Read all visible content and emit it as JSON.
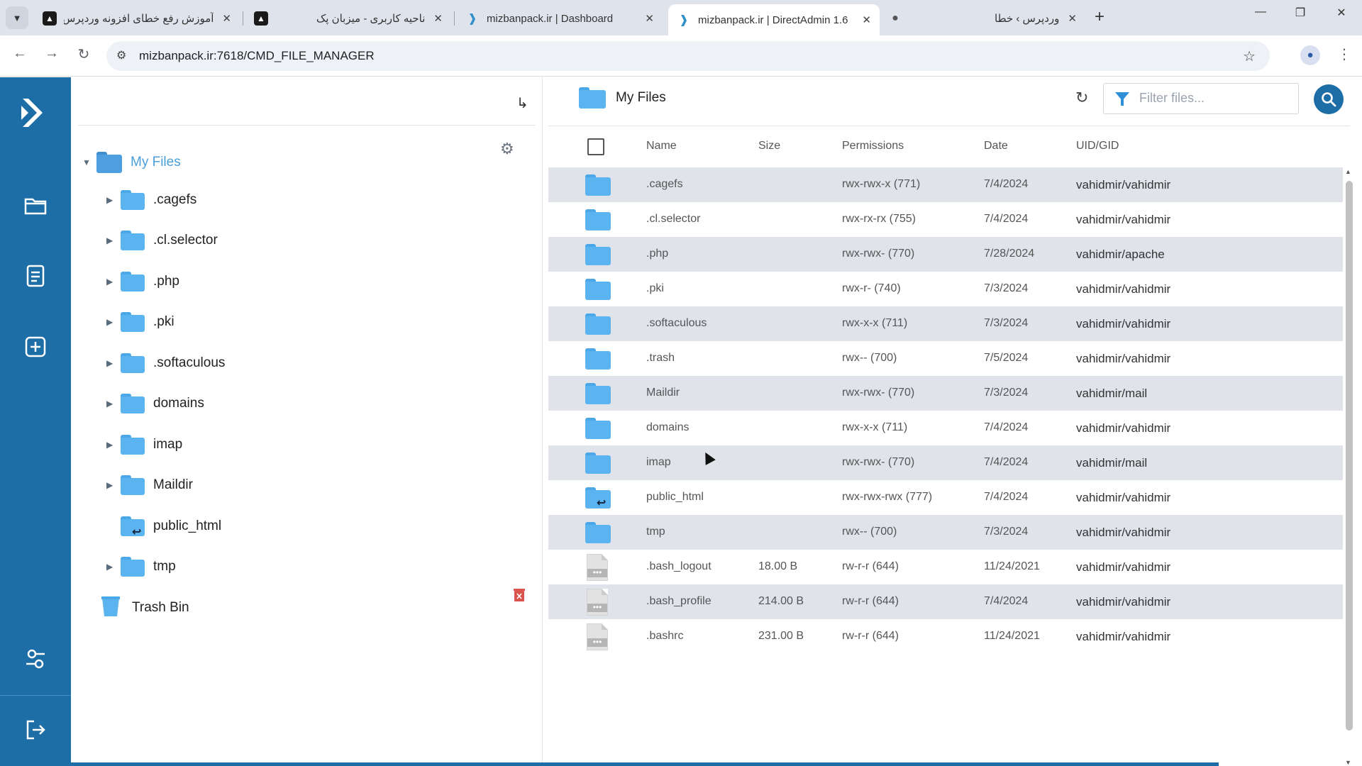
{
  "browser": {
    "tabs": [
      {
        "title": "آموزش رفع خطای افزونه وردپرس",
        "favicon": "tab-logo-icon",
        "active": false
      },
      {
        "title": "ناحیه کاربری - میزبان پک",
        "favicon": "tab-logo-icon",
        "active": false
      },
      {
        "title": "mizbanpack.ir | Dashboard",
        "favicon": "directadmin-icon",
        "active": false
      },
      {
        "title": "mizbanpack.ir | DirectAdmin 1.6",
        "favicon": "directadmin-icon",
        "active": true
      },
      {
        "title": "وردپرس › خطا",
        "favicon": "globe-icon",
        "active": false
      }
    ],
    "url": "mizbanpack.ir:7618/CMD_FILE_MANAGER"
  },
  "colors": {
    "rail": "#1d6ea6",
    "folder": "#5bb3ef",
    "row_alt": "#e0e3ea",
    "delete": "#d9534f"
  },
  "tree": {
    "root_label": "My Files",
    "items": [
      {
        "label": ".cagefs",
        "expandable": true,
        "symlink": false
      },
      {
        "label": ".cl.selector",
        "expandable": true,
        "symlink": false
      },
      {
        "label": ".php",
        "expandable": true,
        "symlink": false
      },
      {
        "label": ".pki",
        "expandable": true,
        "symlink": false
      },
      {
        "label": ".softaculous",
        "expandable": true,
        "symlink": false
      },
      {
        "label": "domains",
        "expandable": true,
        "symlink": false
      },
      {
        "label": "imap",
        "expandable": true,
        "symlink": false
      },
      {
        "label": "Maildir",
        "expandable": true,
        "symlink": false
      },
      {
        "label": "public_html",
        "expandable": false,
        "symlink": true
      },
      {
        "label": "tmp",
        "expandable": true,
        "symlink": false
      }
    ],
    "trash_label": "Trash Bin"
  },
  "main": {
    "breadcrumb": "My Files",
    "filter_placeholder": "Filter files...",
    "columns": {
      "name": "Name",
      "size": "Size",
      "permissions": "Permissions",
      "date": "Date",
      "uid": "UID/GID"
    },
    "rows": [
      {
        "type": "folder",
        "name": ".cagefs",
        "size": "",
        "perm": "rwx-rwx-x (771)",
        "date": "7/4/2024",
        "uid": "vahidmir/vahidmir"
      },
      {
        "type": "folder",
        "name": ".cl.selector",
        "size": "",
        "perm": "rwx-rx-rx (755)",
        "date": "7/4/2024",
        "uid": "vahidmir/vahidmir"
      },
      {
        "type": "folder",
        "name": ".php",
        "size": "",
        "perm": "rwx-rwx- (770)",
        "date": "7/28/2024",
        "uid": "vahidmir/apache"
      },
      {
        "type": "folder",
        "name": ".pki",
        "size": "",
        "perm": "rwx-r- (740)",
        "date": "7/3/2024",
        "uid": "vahidmir/vahidmir"
      },
      {
        "type": "folder",
        "name": ".softaculous",
        "size": "",
        "perm": "rwx-x-x (711)",
        "date": "7/3/2024",
        "uid": "vahidmir/vahidmir"
      },
      {
        "type": "folder",
        "name": ".trash",
        "size": "",
        "perm": "rwx-- (700)",
        "date": "7/5/2024",
        "uid": "vahidmir/vahidmir"
      },
      {
        "type": "folder",
        "name": "Maildir",
        "size": "",
        "perm": "rwx-rwx- (770)",
        "date": "7/3/2024",
        "uid": "vahidmir/mail"
      },
      {
        "type": "folder",
        "name": "domains",
        "size": "",
        "perm": "rwx-x-x (711)",
        "date": "7/4/2024",
        "uid": "vahidmir/vahidmir"
      },
      {
        "type": "folder",
        "name": "imap",
        "size": "",
        "perm": "rwx-rwx- (770)",
        "date": "7/4/2024",
        "uid": "vahidmir/mail"
      },
      {
        "type": "symlink",
        "name": "public_html",
        "size": "",
        "perm": "rwx-rwx-rwx (777)",
        "date": "7/4/2024",
        "uid": "vahidmir/vahidmir"
      },
      {
        "type": "folder",
        "name": "tmp",
        "size": "",
        "perm": "rwx-- (700)",
        "date": "7/3/2024",
        "uid": "vahidmir/vahidmir"
      },
      {
        "type": "file",
        "name": ".bash_logout",
        "size": "18.00 B",
        "perm": "rw-r-r (644)",
        "date": "11/24/2021",
        "uid": "vahidmir/vahidmir"
      },
      {
        "type": "file",
        "name": ".bash_profile",
        "size": "214.00 B",
        "perm": "rw-r-r (644)",
        "date": "7/4/2024",
        "uid": "vahidmir/vahidmir"
      },
      {
        "type": "file",
        "name": ".bashrc",
        "size": "231.00 B",
        "perm": "rw-r-r (644)",
        "date": "11/24/2021",
        "uid": "vahidmir/vahidmir"
      }
    ]
  }
}
